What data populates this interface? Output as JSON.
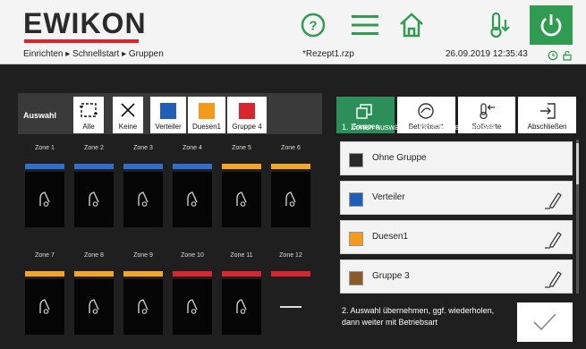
{
  "header": {
    "logo": "EWIKON",
    "breadcrumb": "Einrichten ▸ Schnellstart ▸ Gruppen",
    "recipe": "*Rezept1.rzp",
    "datetime": "26.09.2019 12:35:43",
    "colors": {
      "logo_bar": "#d7262d",
      "power": "#2f9c52"
    },
    "icons": [
      "help-icon",
      "menu-icon",
      "home-icon",
      "temperature-down-icon",
      "power-icon",
      "clock-icon",
      "lock-icon"
    ]
  },
  "selection": {
    "label": "Auswahl",
    "buttons": [
      {
        "label": "Alle",
        "icon": "select-all-icon"
      },
      {
        "label": "Keine",
        "icon": "select-none-icon"
      },
      {
        "label": "Verteiler",
        "color": "#1f5fb8"
      },
      {
        "label": "Duesen1",
        "color": "#f39a1c"
      },
      {
        "label": "Gruppe 4",
        "color": "#d7262d"
      }
    ]
  },
  "zones": [
    {
      "label": "Zone 1",
      "color": "#2f6fd0"
    },
    {
      "label": "Zone 2",
      "color": "#2f6fd0"
    },
    {
      "label": "Zone 3",
      "color": "#2f6fd0"
    },
    {
      "label": "Zone 4",
      "color": "#2f6fd0"
    },
    {
      "label": "Zone 5",
      "color": "#f5a623"
    },
    {
      "label": "Zone 6",
      "color": "#f5a623"
    },
    {
      "label": "Zone 7",
      "color": "#f5a623"
    },
    {
      "label": "Zone 8",
      "color": "#f5a623"
    },
    {
      "label": "Zone 9",
      "color": "#f5a623"
    },
    {
      "label": "Zone 10",
      "color": "#d7262d"
    },
    {
      "label": "Zone 11",
      "color": "#d7262d"
    },
    {
      "label": "Zone 12",
      "color": "#d7262d"
    }
  ],
  "tabs": [
    {
      "label": "Gruppen",
      "active": true,
      "icon": "groups-icon"
    },
    {
      "label": "Betriebsart",
      "active": false,
      "icon": "mode-icon"
    },
    {
      "label": "Sollwerte",
      "active": false,
      "icon": "setpoint-icon"
    },
    {
      "label": "Abschließen",
      "active": false,
      "icon": "finish-icon"
    }
  ],
  "steps": {
    "step1": "1. Zonen auswählen und Gruppe zuweisen",
    "step2": "2. Auswahl übernehmen, ggf. wiederholen, dann weiter mit Betriebsart"
  },
  "groups": [
    {
      "name": "Ohne Gruppe",
      "color": "#2a2a2a",
      "editable": false
    },
    {
      "name": "Verteiler",
      "color": "#1f5fb8",
      "editable": true
    },
    {
      "name": "Duesen1",
      "color": "#f39a1c",
      "editable": true
    },
    {
      "name": "Gruppe 3",
      "color": "#8a5a2b",
      "editable": true
    }
  ]
}
